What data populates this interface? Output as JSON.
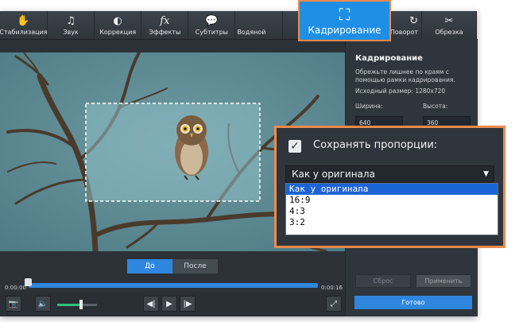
{
  "toolbar": {
    "items": [
      {
        "label": "Стабилизация",
        "icon": "stabilization-icon"
      },
      {
        "label": "Звук",
        "icon": "music-note-icon"
      },
      {
        "label": "Коррекция",
        "icon": "contrast-icon"
      },
      {
        "label": "Эффекты",
        "icon": "fx-icon"
      },
      {
        "label": "Субтитры",
        "icon": "speech-bubble-icon"
      },
      {
        "label": "Водяной",
        "icon": "watermark-icon"
      },
      {
        "label": "Поворот",
        "icon": "rotate-icon"
      },
      {
        "label": "Обрезка",
        "icon": "scissors-icon"
      }
    ],
    "active": {
      "label": "Кадрирование",
      "icon": "crop-icon"
    }
  },
  "preview": {
    "before_label": "До",
    "after_label": "После"
  },
  "timeline": {
    "start": "0:00:00",
    "end": "0:00:16"
  },
  "controls": {
    "volume_level": 0.6
  },
  "panel": {
    "title": "Кадрирование",
    "description": "Обрежьте лишнее по краям с помощью рамки кадрирования.",
    "source_size": "Исходный размер: 1280x720",
    "width_label": "Ширина:",
    "height_label": "Высота:",
    "width_value": "640",
    "height_value": "360",
    "reset_label": "Сброс",
    "apply_label": "Применить",
    "done_label": "Готово"
  },
  "zoom": {
    "keep_aspect_label": "Сохранять пропорции:",
    "keep_aspect_checked": true,
    "selected": "Как у оригинала",
    "options": [
      "Как у оригинала",
      "16:9",
      "4:3",
      "3:2"
    ]
  }
}
